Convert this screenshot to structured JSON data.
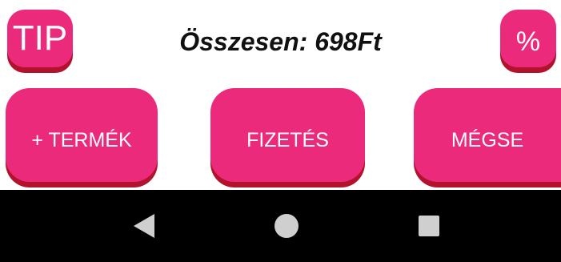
{
  "header": {
    "tip_label": "TIP",
    "total_text": "Összesen: 698Ft",
    "percent_label": "%"
  },
  "actions": {
    "add_product_label": "+ TERMÉK",
    "payment_label": "FIZETÉS",
    "cancel_label": "MÉGSE"
  },
  "navbar": {
    "back_icon": "back-triangle-icon",
    "home_icon": "home-circle-icon",
    "recents_icon": "recents-square-icon"
  },
  "colors": {
    "button": "#ec2a7b",
    "button_shadow": "#b3122d",
    "navbar": "#000000",
    "nav_icons": "#cfcfcf"
  }
}
